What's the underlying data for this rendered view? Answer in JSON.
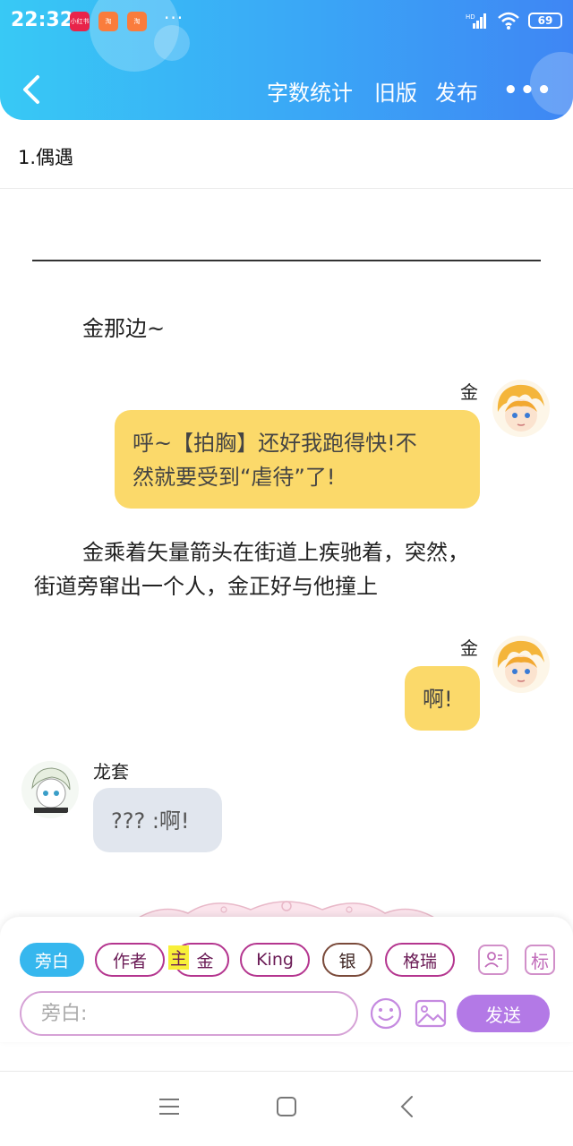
{
  "status_bar": {
    "time": "22:32",
    "app_icon_1": "小红书",
    "app_icon_2": "淘",
    "app_icon_3": "淘",
    "more": "···",
    "network": "HD",
    "battery": "69"
  },
  "header": {
    "word_count_label": "字数统计",
    "old_version_label": "旧版",
    "publish_label": "发布",
    "more_label": "•••"
  },
  "chapter": {
    "title": "1.偶遇"
  },
  "story": {
    "narration_1": "金那边~",
    "msg_1": {
      "speaker": "金",
      "text_line1": "呼~【拍胸】还好我跑得快!不",
      "text_line2": "然就要受到“虐待”了!"
    },
    "narration_2_line1": "金乘着矢量箭头在街道上疾驰着，突然，",
    "narration_2_line2": "街道旁窜出一个人，金正好与他撞上",
    "msg_2": {
      "speaker": "金",
      "text": "啊!"
    },
    "msg_3": {
      "speaker": "龙套",
      "text": "??? :啊!"
    }
  },
  "composer": {
    "roles": [
      "旁白",
      "作者",
      "金",
      "King",
      "银",
      "格瑞"
    ],
    "main_tag": "主",
    "button_mark": "标",
    "input_placeholder": "旁白:",
    "send_label": "发送"
  },
  "colors": {
    "header_gradient_start": "#38c9f5",
    "header_gradient_end": "#3f86f4",
    "bubble_yellow": "#fbd96a",
    "bubble_gray": "#e1e6ee",
    "chip_border": "#b4358f",
    "active_chip": "#36b7ee",
    "send_button": "#b379e6"
  }
}
